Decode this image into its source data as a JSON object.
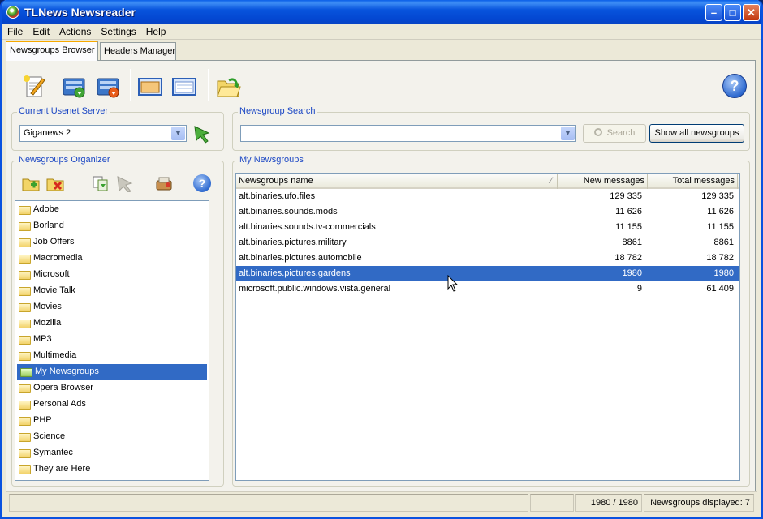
{
  "window": {
    "title": "TLNews Newsreader"
  },
  "menu": [
    "File",
    "Edit",
    "Actions",
    "Settings",
    "Help"
  ],
  "tabs": [
    "Newsgroups Browser",
    "Headers Manager"
  ],
  "toolbar": {
    "icons": [
      "new-message-icon",
      "download-newsgroups-icon",
      "download-headers-icon",
      "view-panel-icon",
      "view-list-icon",
      "open-folder-icon",
      "help-icon"
    ]
  },
  "server": {
    "legend": "Current Usenet Server",
    "value": "Giganews 2"
  },
  "search": {
    "legend": "Newsgroup Search",
    "value": "",
    "search_label": "Search",
    "show_all_label": "Show all newsgroups"
  },
  "organizer": {
    "legend": "Newsgroups Organizer",
    "folders": [
      "Adobe",
      "Borland",
      "Job Offers",
      "Macromedia",
      "Microsoft",
      "Movie Talk",
      "Movies",
      "Mozilla",
      "MP3",
      "Multimedia",
      "My Newsgroups",
      "Opera Browser",
      "Personal Ads",
      "PHP",
      "Science",
      "Symantec",
      "They are Here"
    ],
    "selected": "My Newsgroups"
  },
  "my_newsgroups": {
    "legend": "My Newsgroups",
    "columns": [
      "Newsgroups name",
      "New messages",
      "Total messages"
    ],
    "rows": [
      [
        "alt.binaries.ufo.files",
        "129 335",
        "129 335"
      ],
      [
        "alt.binaries.sounds.mods",
        "11 626",
        "11 626"
      ],
      [
        "alt.binaries.sounds.tv-commercials",
        "11 155",
        "11 155"
      ],
      [
        "alt.binaries.pictures.military",
        "8861",
        "8861"
      ],
      [
        "alt.binaries.pictures.automobile",
        "18 782",
        "18 782"
      ],
      [
        "alt.binaries.pictures.gardens",
        "1980",
        "1980"
      ],
      [
        "microsoft.public.windows.vista.general",
        "9",
        "61 409"
      ]
    ],
    "selected_row": 5
  },
  "status": {
    "count": "1980 / 1980",
    "displayed": "Newsgroups displayed: 7"
  },
  "colors": {
    "accent": "#316ac5",
    "legend": "#1b47c4",
    "titlebar": "#0346d1"
  }
}
